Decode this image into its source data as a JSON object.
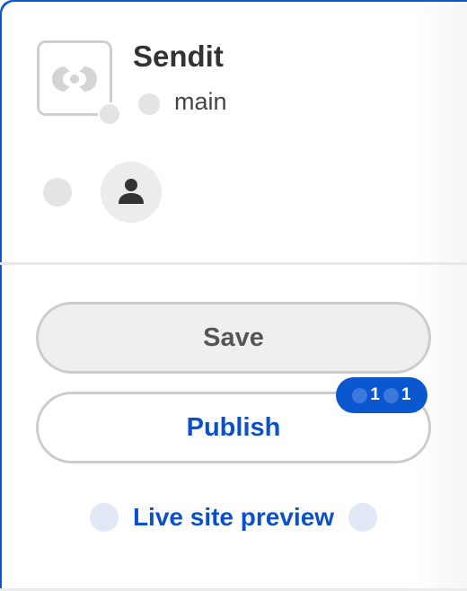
{
  "site": {
    "name": "Sendit",
    "branch": "main"
  },
  "actions": {
    "save_label": "Save",
    "publish_label": "Publish",
    "badge_count_a": "1",
    "badge_count_b": "1",
    "preview_label": "Live site preview"
  },
  "icons": {
    "logo": "brand-logo-icon",
    "branch": "branch-icon",
    "user": "user-icon"
  },
  "colors": {
    "accent": "#0b57d0",
    "link": "#0b4fc9",
    "save_bg": "#efefef"
  }
}
